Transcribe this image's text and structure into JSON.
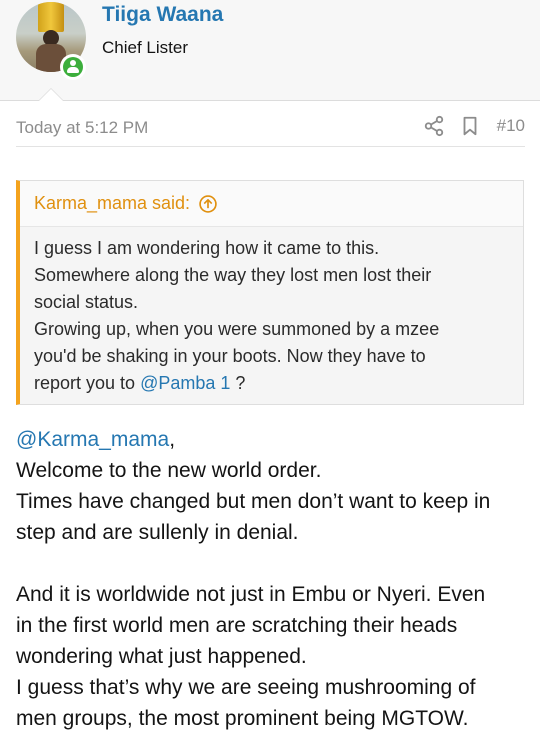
{
  "user": {
    "name": "Tiiga Waana",
    "title": "Chief Lister"
  },
  "post": {
    "timestamp": "Today at 5:12 PM",
    "number": "#10"
  },
  "quote": {
    "author_label": "Karma_mama said:",
    "lines": [
      "I guess I am wondering how it came to this.",
      "Somewhere along the way they lost men lost their",
      "social status.",
      "Growing up, when you were summoned by a mzee",
      "you'd be shaking in your boots. Now they have to"
    ],
    "last_line_prefix": "report you to",
    "last_line_mention": "@Pamba 1",
    "last_line_suffix": "?"
  },
  "reply": {
    "mention": "@Karma_mama",
    "mention_suffix": ",",
    "line1": "Welcome to the new world order.",
    "line2": "Times have changed but men don’t want to keep in",
    "line3": "step and are sullenly in denial.",
    "line4": "And it is worldwide not just in Embu or Nyeri. Even",
    "line5": "in the first world men are scratching their heads",
    "line6": "wondering what just happened.",
    "line7": "I guess that’s why we are seeing mushrooming of",
    "line8": "men groups, the most prominent being MGTOW."
  },
  "colors": {
    "link": "#2577b1",
    "quote_accent": "#f4a31d",
    "online": "#3cae3c"
  },
  "icons": {
    "share": "share-icon",
    "bookmark": "bookmark-icon",
    "quote_jump": "arrow-up-circle-icon",
    "online": "user-online-icon"
  }
}
